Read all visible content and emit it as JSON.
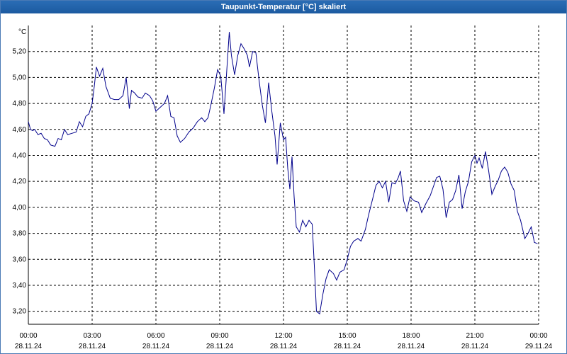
{
  "window": {
    "title": "Taupunkt-Temperatur [°C] skaliert"
  },
  "chart_data": {
    "type": "line",
    "title": "Taupunkt-Temperatur [°C] skaliert",
    "ylabel": "°C",
    "xlabel": "",
    "ylim": [
      3.1,
      5.4
    ],
    "xlim_hours": [
      0,
      24
    ],
    "grid": true,
    "grid_style": "dashed",
    "line_color": "#00008b",
    "y_ticks": [
      {
        "value": 3.2,
        "label": "3,20"
      },
      {
        "value": 3.4,
        "label": "3,40"
      },
      {
        "value": 3.6,
        "label": "3,60"
      },
      {
        "value": 3.8,
        "label": "3,80"
      },
      {
        "value": 4.0,
        "label": "4,00"
      },
      {
        "value": 4.2,
        "label": "4,20"
      },
      {
        "value": 4.4,
        "label": "4,40"
      },
      {
        "value": 4.6,
        "label": "4,60"
      },
      {
        "value": 4.8,
        "label": "4,80"
      },
      {
        "value": 5.0,
        "label": "5,00"
      },
      {
        "value": 5.2,
        "label": "5,20"
      }
    ],
    "x_ticks": [
      {
        "hour": 0,
        "time": "00:00",
        "date": "28.11.24"
      },
      {
        "hour": 3,
        "time": "03:00",
        "date": "28.11.24"
      },
      {
        "hour": 6,
        "time": "06:00",
        "date": "28.11.24"
      },
      {
        "hour": 9,
        "time": "09:00",
        "date": "28.11.24"
      },
      {
        "hour": 12,
        "time": "12:00",
        "date": "28.11.24"
      },
      {
        "hour": 15,
        "time": "15:00",
        "date": "28.11.24"
      },
      {
        "hour": 18,
        "time": "18:00",
        "date": "28.11.24"
      },
      {
        "hour": 21,
        "time": "21:00",
        "date": "28.11.24"
      },
      {
        "hour": 24,
        "time": "00:00",
        "date": "29.11.24"
      }
    ],
    "series": [
      {
        "points": [
          [
            0.0,
            4.66
          ],
          [
            0.1,
            4.6
          ],
          [
            0.2,
            4.59
          ],
          [
            0.3,
            4.6
          ],
          [
            0.45,
            4.56
          ],
          [
            0.6,
            4.57
          ],
          [
            0.75,
            4.53
          ],
          [
            0.9,
            4.52
          ],
          [
            1.05,
            4.48
          ],
          [
            1.25,
            4.47
          ],
          [
            1.4,
            4.53
          ],
          [
            1.55,
            4.52
          ],
          [
            1.7,
            4.6
          ],
          [
            1.85,
            4.56
          ],
          [
            2.05,
            4.57
          ],
          [
            2.25,
            4.58
          ],
          [
            2.4,
            4.66
          ],
          [
            2.55,
            4.62
          ],
          [
            2.7,
            4.7
          ],
          [
            2.85,
            4.72
          ],
          [
            3.0,
            4.8
          ],
          [
            3.1,
            4.93
          ],
          [
            3.2,
            5.08
          ],
          [
            3.35,
            5.01
          ],
          [
            3.5,
            5.07
          ],
          [
            3.65,
            4.93
          ],
          [
            3.85,
            4.84
          ],
          [
            4.05,
            4.83
          ],
          [
            4.25,
            4.83
          ],
          [
            4.45,
            4.86
          ],
          [
            4.6,
            5.0
          ],
          [
            4.75,
            4.76
          ],
          [
            4.85,
            4.9
          ],
          [
            5.0,
            4.88
          ],
          [
            5.15,
            4.85
          ],
          [
            5.35,
            4.84
          ],
          [
            5.5,
            4.88
          ],
          [
            5.7,
            4.86
          ],
          [
            5.85,
            4.82
          ],
          [
            6.0,
            4.74
          ],
          [
            6.2,
            4.77
          ],
          [
            6.4,
            4.8
          ],
          [
            6.55,
            4.86
          ],
          [
            6.7,
            4.7
          ],
          [
            6.85,
            4.69
          ],
          [
            7.0,
            4.55
          ],
          [
            7.15,
            4.5
          ],
          [
            7.35,
            4.53
          ],
          [
            7.55,
            4.58
          ],
          [
            7.75,
            4.61
          ],
          [
            7.95,
            4.66
          ],
          [
            8.15,
            4.69
          ],
          [
            8.3,
            4.66
          ],
          [
            8.45,
            4.69
          ],
          [
            8.6,
            4.8
          ],
          [
            8.75,
            4.92
          ],
          [
            8.9,
            5.06
          ],
          [
            9.05,
            5.01
          ],
          [
            9.2,
            4.72
          ],
          [
            9.35,
            5.1
          ],
          [
            9.45,
            5.35
          ],
          [
            9.55,
            5.17
          ],
          [
            9.7,
            5.02
          ],
          [
            9.85,
            5.17
          ],
          [
            10.0,
            5.26
          ],
          [
            10.15,
            5.22
          ],
          [
            10.3,
            5.17
          ],
          [
            10.4,
            5.08
          ],
          [
            10.55,
            5.2
          ],
          [
            10.7,
            5.19
          ],
          [
            10.85,
            4.98
          ],
          [
            11.0,
            4.79
          ],
          [
            11.15,
            4.65
          ],
          [
            11.3,
            4.96
          ],
          [
            11.45,
            4.74
          ],
          [
            11.6,
            4.55
          ],
          [
            11.7,
            4.33
          ],
          [
            11.85,
            4.65
          ],
          [
            12.0,
            4.52
          ],
          [
            12.1,
            4.54
          ],
          [
            12.2,
            4.3
          ],
          [
            12.3,
            4.14
          ],
          [
            12.4,
            4.39
          ],
          [
            12.5,
            4.08
          ],
          [
            12.6,
            3.85
          ],
          [
            12.75,
            3.81
          ],
          [
            12.9,
            3.9
          ],
          [
            13.05,
            3.85
          ],
          [
            13.2,
            3.9
          ],
          [
            13.35,
            3.87
          ],
          [
            13.45,
            3.55
          ],
          [
            13.55,
            3.2
          ],
          [
            13.7,
            3.18
          ],
          [
            13.85,
            3.33
          ],
          [
            14.0,
            3.45
          ],
          [
            14.15,
            3.52
          ],
          [
            14.35,
            3.49
          ],
          [
            14.5,
            3.44
          ],
          [
            14.65,
            3.5
          ],
          [
            14.85,
            3.52
          ],
          [
            15.0,
            3.6
          ],
          [
            15.15,
            3.7
          ],
          [
            15.3,
            3.74
          ],
          [
            15.5,
            3.76
          ],
          [
            15.65,
            3.74
          ],
          [
            15.85,
            3.83
          ],
          [
            16.0,
            3.94
          ],
          [
            16.2,
            4.07
          ],
          [
            16.35,
            4.17
          ],
          [
            16.5,
            4.2
          ],
          [
            16.65,
            4.15
          ],
          [
            16.8,
            4.2
          ],
          [
            16.95,
            4.04
          ],
          [
            17.1,
            4.19
          ],
          [
            17.25,
            4.18
          ],
          [
            17.4,
            4.23
          ],
          [
            17.5,
            4.28
          ],
          [
            17.65,
            4.05
          ],
          [
            17.8,
            3.97
          ],
          [
            17.95,
            4.08
          ],
          [
            18.15,
            4.05
          ],
          [
            18.35,
            4.04
          ],
          [
            18.5,
            3.96
          ],
          [
            18.7,
            4.03
          ],
          [
            18.9,
            4.09
          ],
          [
            19.05,
            4.16
          ],
          [
            19.2,
            4.23
          ],
          [
            19.35,
            4.24
          ],
          [
            19.5,
            4.14
          ],
          [
            19.65,
            3.92
          ],
          [
            19.8,
            4.04
          ],
          [
            19.95,
            4.06
          ],
          [
            20.1,
            4.13
          ],
          [
            20.25,
            4.25
          ],
          [
            20.4,
            3.99
          ],
          [
            20.55,
            4.12
          ],
          [
            20.7,
            4.2
          ],
          [
            20.85,
            4.35
          ],
          [
            21.0,
            4.4
          ],
          [
            21.1,
            4.34
          ],
          [
            21.2,
            4.38
          ],
          [
            21.35,
            4.3
          ],
          [
            21.5,
            4.43
          ],
          [
            21.65,
            4.28
          ],
          [
            21.8,
            4.1
          ],
          [
            21.95,
            4.16
          ],
          [
            22.1,
            4.21
          ],
          [
            22.25,
            4.28
          ],
          [
            22.4,
            4.31
          ],
          [
            22.55,
            4.27
          ],
          [
            22.7,
            4.18
          ],
          [
            22.85,
            4.13
          ],
          [
            23.0,
            3.97
          ],
          [
            23.15,
            3.9
          ],
          [
            23.35,
            3.76
          ],
          [
            23.5,
            3.8
          ],
          [
            23.65,
            3.85
          ],
          [
            23.8,
            3.73
          ],
          [
            23.95,
            3.72
          ]
        ]
      }
    ]
  }
}
